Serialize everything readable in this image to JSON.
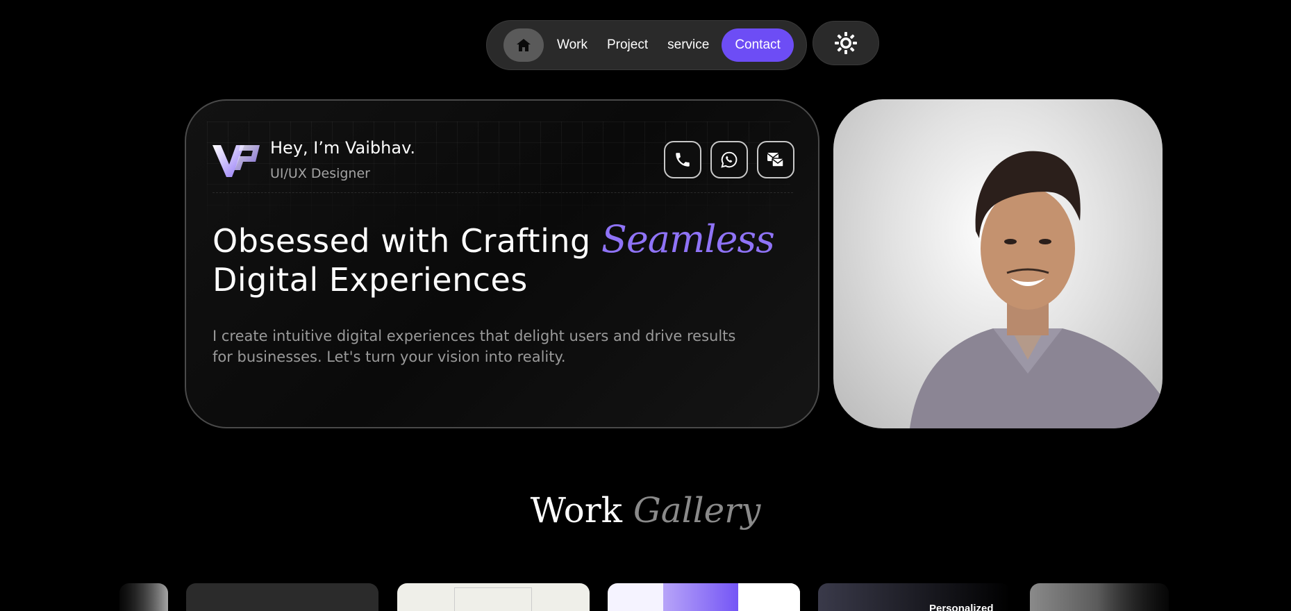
{
  "nav": {
    "items": [
      "Work",
      "Project",
      "service"
    ],
    "contact_label": "Contact",
    "home_icon": "home-icon",
    "theme_icon": "sun-icon"
  },
  "hero": {
    "greeting": "Hey, I’m Vaibhav.",
    "role": "UI/UX Designer",
    "headline_part1": "Obsessed with Crafting ",
    "headline_accent": "Seamless",
    "headline_part2": "Digital Experiences",
    "description": "I create intuitive digital experiences that delight users and drive results for businesses. Let's turn your vision into reality.",
    "contact_icons": [
      "phone-icon",
      "whatsapp-icon",
      "mail-icon"
    ]
  },
  "gallery": {
    "title_main": "Work",
    "title_accent": "Gallery",
    "card_texts": [
      "Personalized"
    ]
  },
  "colors": {
    "accent": "#6d4df5",
    "accent_text": "#8f73f7",
    "background": "#000000"
  }
}
